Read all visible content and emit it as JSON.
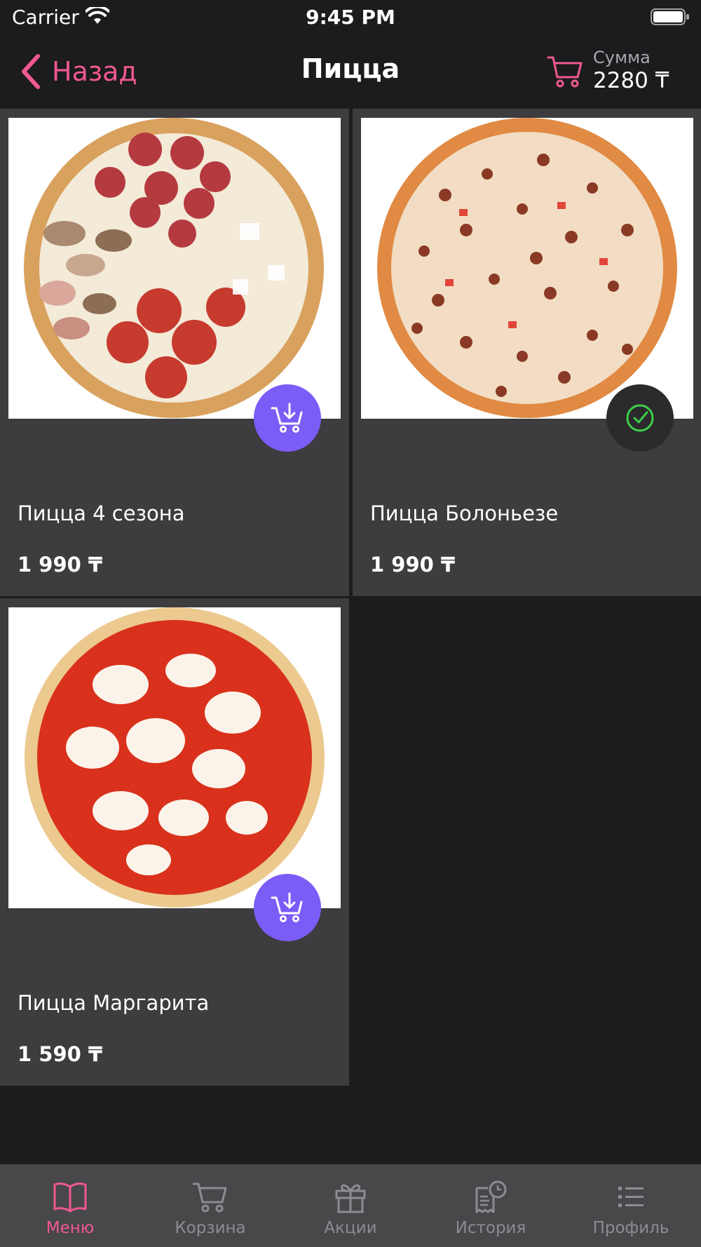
{
  "status_bar": {
    "carrier": "Carrier",
    "time": "9:45 PM"
  },
  "nav": {
    "back_label": "Назад",
    "title": "Пицца",
    "sum_label": "Сумма",
    "sum_value": "2280 ₸"
  },
  "products": [
    {
      "name": "Пицца 4 сезона",
      "price": "1 990 ₸",
      "in_cart": false
    },
    {
      "name": "Пицца Болоньезе",
      "price": "1 990 ₸",
      "in_cart": true
    },
    {
      "name": "Пицца Маргарита",
      "price": "1 590 ₸",
      "in_cart": false
    }
  ],
  "tabs": [
    {
      "label": "Меню",
      "icon": "book-icon",
      "active": true
    },
    {
      "label": "Корзина",
      "icon": "cart-icon",
      "active": false
    },
    {
      "label": "Акции",
      "icon": "gift-icon",
      "active": false
    },
    {
      "label": "История",
      "icon": "receipt-clock-icon",
      "active": false
    },
    {
      "label": "Профиль",
      "icon": "list-icon",
      "active": false
    }
  ],
  "colors": {
    "accent": "#f0598f",
    "add_button": "#7b5cf6",
    "check": "#3ecf4a",
    "card_bg": "#3d3c3e",
    "screen_bg": "#1c1b1d",
    "tab_bar_bg": "#48474a"
  }
}
